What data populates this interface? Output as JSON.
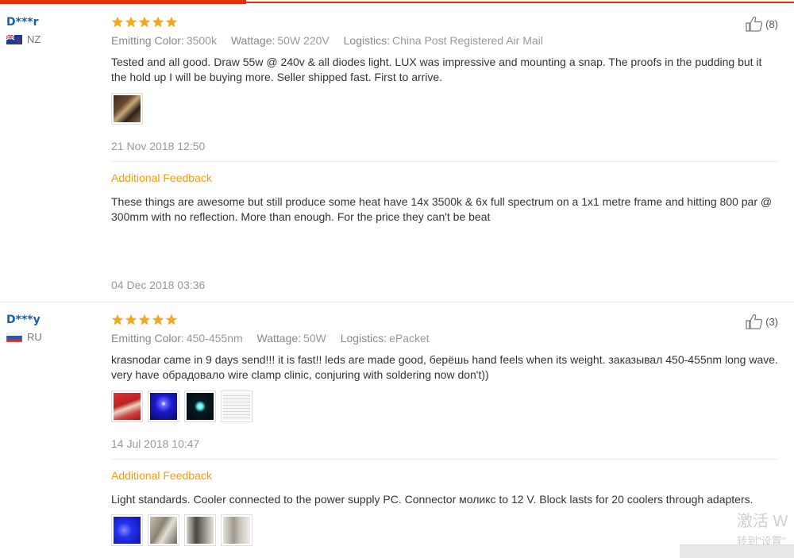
{
  "reviews": [
    {
      "buyer": "D***r",
      "country": "NZ",
      "rating": 5,
      "helpful_count": "(8)",
      "meta": [
        {
          "label": "Emitting Color:",
          "value": "3500k"
        },
        {
          "label": "Wattage:",
          "value": "50W 220V"
        },
        {
          "label": "Logistics:",
          "value": "China Post Registered Air Mail"
        }
      ],
      "text": "Tested and all good. Draw 55w @ 240v & all diodes light. LUX was impressive and mounting a snap. The proofs in the pudding but it the hold up I will be buying more. Seller shipped fast. First to arrive.",
      "date": "21 Nov 2018 12:50",
      "additional": {
        "title": "Additional Feedback",
        "text": "These things are awesome but still produce some heat have 14x 3500k & 6x full spectrum on a 1x1 metre frame and hitting 800 par @ 300mm with no reflection. More than enough. For the price they can't be beat",
        "date": "04 Dec 2018 03:36"
      }
    },
    {
      "buyer": "D***y",
      "country": "RU",
      "rating": 5,
      "helpful_count": "(3)",
      "meta": [
        {
          "label": "Emitting Color:",
          "value": "450-455nm"
        },
        {
          "label": "Wattage:",
          "value": "50W"
        },
        {
          "label": "Logistics:",
          "value": "ePacket"
        }
      ],
      "text": "krasnodar came in 9 days send!!! it is fast!! leds are made good, берёшь hand feels when its weight. заказывал 450-455nm long wave. very have обрадовало wire clamp clinic, conjuring with soldering now don't))",
      "date": "14 Jul 2018 10:47",
      "additional": {
        "title": "Additional Feedback",
        "text": "Light standards. Cooler connected to the power supply PC. Connector моликс to 12 V. Block lasts for 20 coolers through adapters."
      }
    }
  ],
  "watermark": {
    "line1": "激活 W",
    "line2": "转到\"设置\""
  },
  "colors": {
    "accent": "#e62e04",
    "star": "#f5a623",
    "additional": "#ff9900",
    "buyer": "#1a5fb4"
  }
}
